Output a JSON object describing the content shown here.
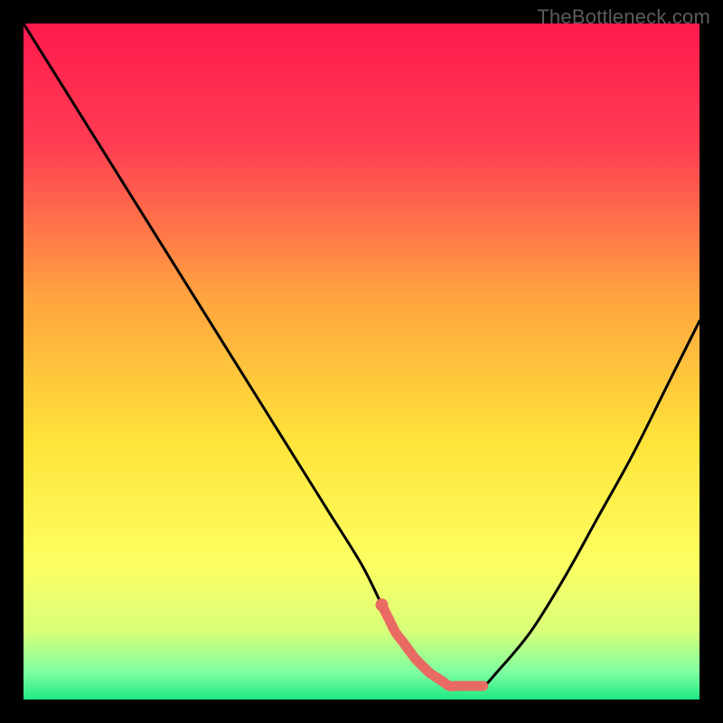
{
  "watermark": "TheBottleneck.com",
  "colors": {
    "frame": "#000000",
    "gradient_stops": [
      {
        "offset": 0.0,
        "color": "#ff1a4d"
      },
      {
        "offset": 0.18,
        "color": "#ff3d53"
      },
      {
        "offset": 0.4,
        "color": "#ffa23f"
      },
      {
        "offset": 0.62,
        "color": "#ffe43a"
      },
      {
        "offset": 0.8,
        "color": "#fdff62"
      },
      {
        "offset": 0.9,
        "color": "#d7ff7a"
      },
      {
        "offset": 0.96,
        "color": "#7dffa2"
      },
      {
        "offset": 1.0,
        "color": "#20e884"
      }
    ],
    "curve": "#000000",
    "highlight": "#e96a63"
  },
  "chart_data": {
    "type": "line",
    "title": "",
    "xlabel": "",
    "ylabel": "",
    "xlim": [
      0,
      100
    ],
    "ylim": [
      0,
      100
    ],
    "x": [
      0,
      5,
      10,
      15,
      20,
      25,
      30,
      35,
      40,
      45,
      50,
      53,
      55,
      58,
      60,
      63,
      66,
      68,
      70,
      75,
      80,
      85,
      90,
      95,
      100
    ],
    "values": [
      100,
      92,
      84,
      76,
      68,
      60,
      52,
      44,
      36,
      28,
      20,
      14,
      10,
      6,
      4,
      2,
      2,
      2,
      4,
      10,
      18,
      27,
      36,
      46,
      56
    ],
    "highlight_segment": {
      "x_start": 53,
      "x_end": 68
    },
    "highlight_dot": {
      "x": 53,
      "y": 14
    },
    "notes": "V-shaped bottleneck curve on rainbow heat background; minimum near x≈65, y≈2. Values read from pixel grid; axes unlabeled."
  }
}
